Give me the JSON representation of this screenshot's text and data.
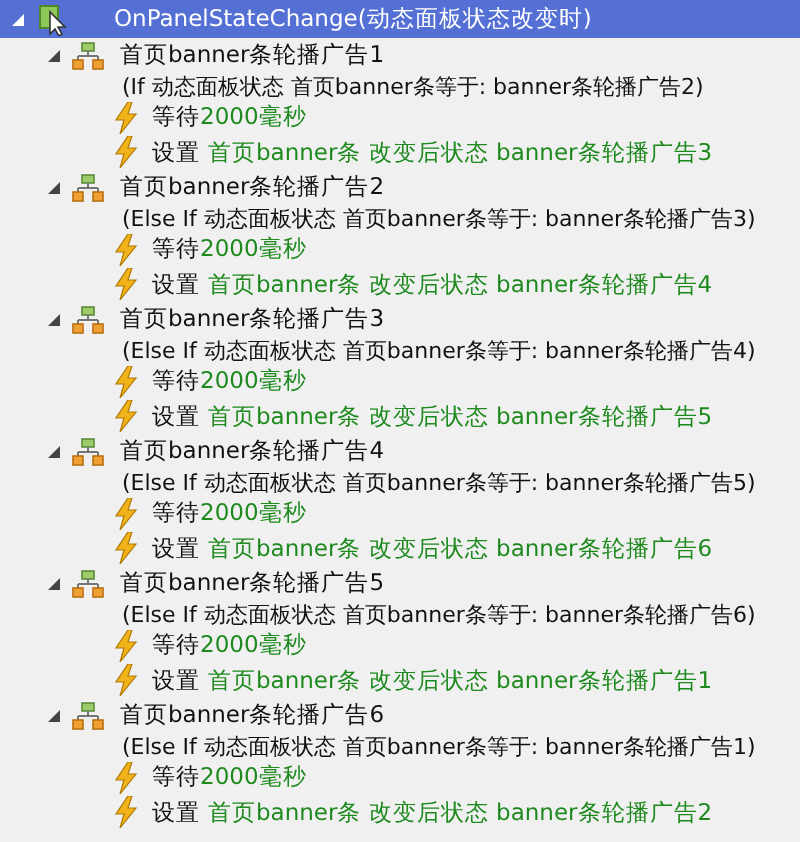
{
  "event": {
    "name": "OnPanelStateChange(动态面板状态改变时)",
    "selected": true,
    "expanded": true,
    "cases": [
      {
        "name": "首页banner条轮播广告1",
        "condition": "(If 动态面板状态 首页banner条等于: banner条轮播广告2)",
        "expanded": true,
        "actions": [
          {
            "kind": "wait",
            "verb": "等待",
            "detail": "2000毫秒"
          },
          {
            "kind": "set",
            "verb": "设置",
            "detail": "首页banner条 改变后状态 banner条轮播广告3"
          }
        ]
      },
      {
        "name": "首页banner条轮播广告2",
        "condition": "(Else If 动态面板状态 首页banner条等于: banner条轮播广告3)",
        "expanded": true,
        "actions": [
          {
            "kind": "wait",
            "verb": "等待",
            "detail": "2000毫秒"
          },
          {
            "kind": "set",
            "verb": "设置",
            "detail": "首页banner条 改变后状态 banner条轮播广告4"
          }
        ]
      },
      {
        "name": "首页banner条轮播广告3",
        "condition": "(Else If 动态面板状态 首页banner条等于: banner条轮播广告4)",
        "expanded": true,
        "actions": [
          {
            "kind": "wait",
            "verb": "等待",
            "detail": "2000毫秒"
          },
          {
            "kind": "set",
            "verb": "设置",
            "detail": "首页banner条 改变后状态 banner条轮播广告5"
          }
        ]
      },
      {
        "name": "首页banner条轮播广告4",
        "condition": "(Else If 动态面板状态 首页banner条等于: banner条轮播广告5)",
        "expanded": true,
        "actions": [
          {
            "kind": "wait",
            "verb": "等待",
            "detail": "2000毫秒"
          },
          {
            "kind": "set",
            "verb": "设置",
            "detail": "首页banner条 改变后状态 banner条轮播广告6"
          }
        ]
      },
      {
        "name": "首页banner条轮播广告5",
        "condition": "(Else If 动态面板状态 首页banner条等于: banner条轮播广告6)",
        "expanded": true,
        "actions": [
          {
            "kind": "wait",
            "verb": "等待",
            "detail": "2000毫秒"
          },
          {
            "kind": "set",
            "verb": "设置",
            "detail": "首页banner条 改变后状态 banner条轮播广告1"
          }
        ]
      },
      {
        "name": "首页banner条轮播广告6",
        "condition": "(Else If 动态面板状态 首页banner条等于: banner条轮播广告1)",
        "expanded": true,
        "actions": [
          {
            "kind": "wait",
            "verb": "等待",
            "detail": "2000毫秒"
          },
          {
            "kind": "set",
            "verb": "设置",
            "detail": "首页banner条 改变后状态 banner条轮播广告2"
          }
        ]
      }
    ]
  }
}
